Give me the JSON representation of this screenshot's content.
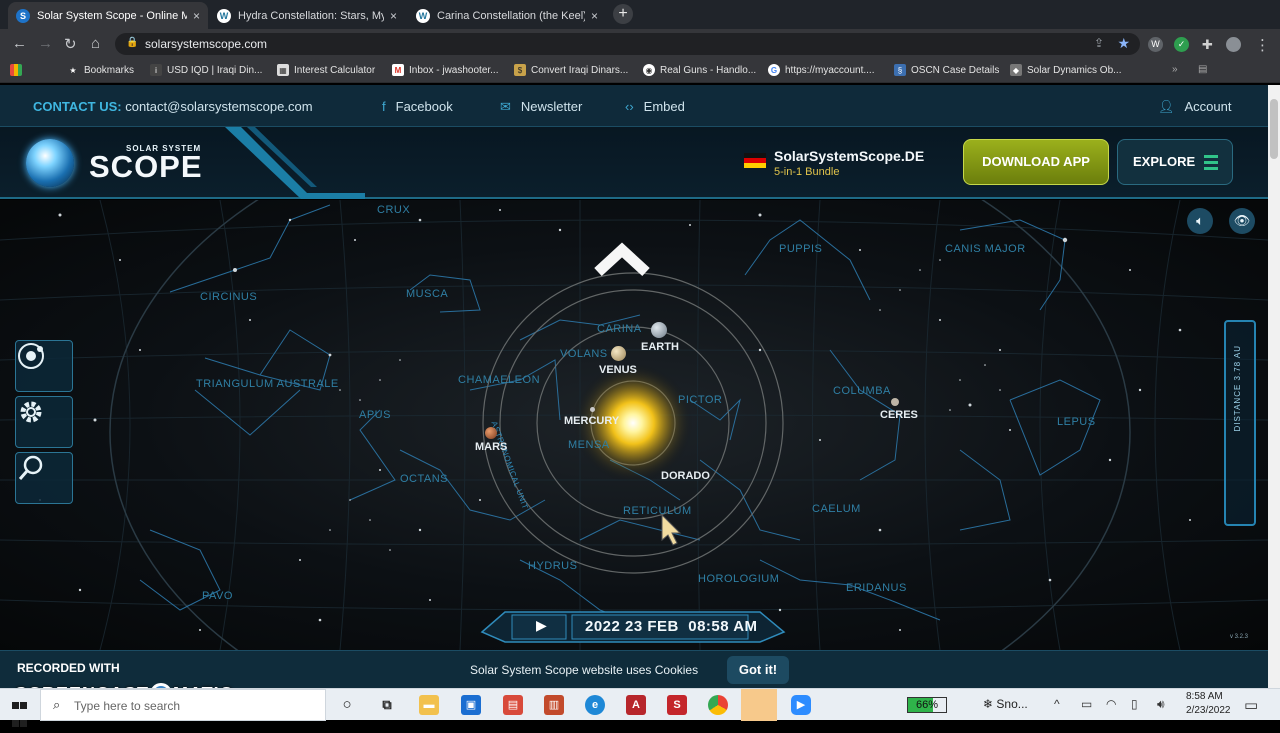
{
  "browser": {
    "tabs": [
      {
        "title": "Solar System Scope - Online Mo",
        "close": "×"
      },
      {
        "title": "Hydra Constellation: Stars, Myth",
        "close": "×"
      },
      {
        "title": "Carina Constellation (the Keel): St",
        "close": "×"
      }
    ],
    "new_tab": "+",
    "url": "solarsystemscope.com",
    "bookmarks": [
      {
        "label": "Bookmarks",
        "icon": "star-icon"
      },
      {
        "label": "USD IQD | Iraqi Din...",
        "icon": "inv-icon"
      },
      {
        "label": "Interest Calculator",
        "icon": "calculator-icon"
      },
      {
        "label": "Inbox - jwashooter...",
        "icon": "gmail-icon"
      },
      {
        "label": "Convert Iraqi Dinars...",
        "icon": "exchange-icon"
      },
      {
        "label": "Real Guns - Handlo...",
        "icon": "globe-icon"
      },
      {
        "label": "https://myaccount....",
        "icon": "google-icon"
      },
      {
        "label": "OSCN Case Details",
        "icon": "oscn-icon"
      },
      {
        "label": "Solar Dynamics Ob...",
        "icon": "sdo-icon"
      }
    ],
    "bookmarks_overflow": "»"
  },
  "site": {
    "contact_label": "CONTACT US:",
    "contact_email": "contact@solarsystemscope.com",
    "facebook": "Facebook",
    "newsletter": "Newsletter",
    "embed": "Embed",
    "account": "Account",
    "logo_small": "SOLAR SYSTEM",
    "logo_big": "SCOPE",
    "de_title": "SolarSystemScope.DE",
    "de_sub": "5-in-1 Bundle",
    "download": "DOWNLOAD APP",
    "explore": "EXPLORE"
  },
  "sky": {
    "constellations": [
      {
        "name": "CRUX"
      },
      {
        "name": "PUPPIS"
      },
      {
        "name": "CANIS MAJOR"
      },
      {
        "name": "CIRCINUS"
      },
      {
        "name": "MUSCA"
      },
      {
        "name": "CARINA"
      },
      {
        "name": "VOLANS"
      },
      {
        "name": "TRIANGULUM AUSTRALE"
      },
      {
        "name": "CHAMAELEON"
      },
      {
        "name": "COLUMBA"
      },
      {
        "name": "PICTOR"
      },
      {
        "name": "APUS"
      },
      {
        "name": "LEPUS"
      },
      {
        "name": "MENSA"
      },
      {
        "name": "OCTANS"
      },
      {
        "name": "CAELUM"
      },
      {
        "name": "RETICULUM"
      },
      {
        "name": "HYDRUS"
      },
      {
        "name": "HOROLOGIUM"
      },
      {
        "name": "PAVO"
      },
      {
        "name": "ERIDANUS"
      }
    ],
    "planets": [
      {
        "name": "EARTH"
      },
      {
        "name": "VENUS"
      },
      {
        "name": "MERCURY"
      },
      {
        "name": "MARS"
      },
      {
        "name": "CERES"
      },
      {
        "name": "DORADO"
      }
    ],
    "ring_label": "ASTRONOMICAL UNIT",
    "distance_label": "DISTANCE 3.78 AU",
    "date": "2022 23 FEB",
    "time": "08:58 AM",
    "version": "v 3.2.3"
  },
  "cookie": {
    "message": "Solar System Scope website uses Cookies",
    "button": "Got it!"
  },
  "watermark": {
    "line1": "RECORDED WITH",
    "line2a": "SCREENCAST",
    "line2b": "MATIC"
  },
  "taskbar": {
    "search_placeholder": "Type here to search",
    "battery": "66%",
    "battery_level": 0.66,
    "weather": "Sno...",
    "time": "8:58 AM",
    "date": "2/23/2022"
  }
}
